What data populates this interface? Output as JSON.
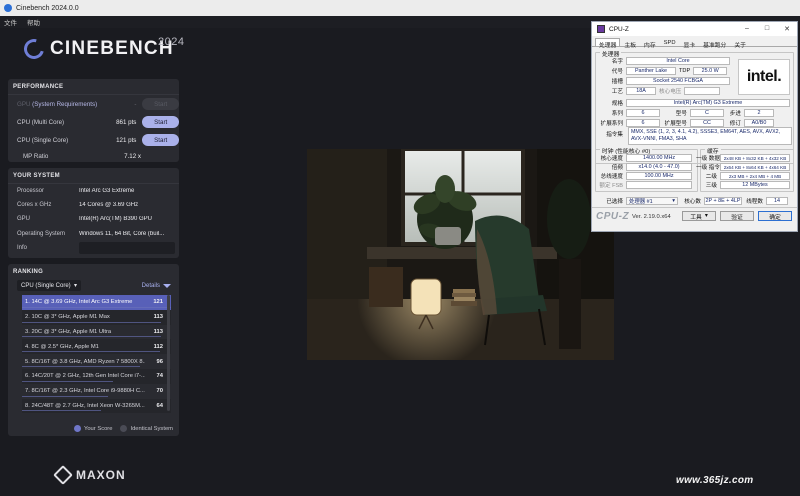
{
  "window": {
    "title": "Cinebench 2024.0.0"
  },
  "menu": {
    "file": "文件",
    "help": "帮助"
  },
  "brand": {
    "name": "CINEBENCH",
    "year": "2024",
    "footer": "MAXON"
  },
  "performance": {
    "heading": "PERFORMANCE",
    "gpu": {
      "label_main": "GPU",
      "label_extra": "(System Requirements)",
      "value": "-",
      "button": "Start"
    },
    "multi": {
      "label": "CPU (Multi Core)",
      "value": "861 pts",
      "button": "Start"
    },
    "single": {
      "label": "CPU (Single Core)",
      "value": "121 pts",
      "button": "Start"
    },
    "ratio": {
      "label": "MP Ratio",
      "value": "7.12 x"
    }
  },
  "system": {
    "heading": "YOUR SYSTEM",
    "rows": [
      {
        "key": "Processor",
        "value": "Intel Arc G3 Extreme"
      },
      {
        "key": "Cores x GHz",
        "value": "14 Cores @ 3.69 GHz"
      },
      {
        "key": "GPU",
        "value": "Intel(R) Arc(TM) B390 GPU"
      },
      {
        "key": "Operating System",
        "value": "Windows 11, 64 Bit, Core (buil..."
      },
      {
        "key": "Info",
        "value": ""
      }
    ]
  },
  "ranking": {
    "heading": "RANKING",
    "mode": "CPU (Single Core)",
    "details": "Details",
    "items": [
      {
        "text": "1. 14C @ 3.69 GHz, Intel Arc G3 Extreme",
        "score": "121"
      },
      {
        "text": "2. 10C @ 3* GHz, Apple M1 Max",
        "score": "113"
      },
      {
        "text": "3. 20C @ 3* GHz, Apple M1 Ultra",
        "score": "113"
      },
      {
        "text": "4. 8C @ 2.5* GHz, Apple M1",
        "score": "112"
      },
      {
        "text": "5. 8C/16T @ 3.8 GHz, AMD Ryzen 7 5800X 8...",
        "score": "96"
      },
      {
        "text": "6. 14C/20T @ 2 GHz, 12th Gen Intel Core i7-...",
        "score": "74"
      },
      {
        "text": "7. 8C/16T @ 2.3 GHz, Intel Core i9-9880H C...",
        "score": "70"
      },
      {
        "text": "8. 24C/48T @ 2.7 GHz, Intel Xeon W-3265M...",
        "score": "64"
      }
    ],
    "legend": {
      "yours": "Your Score",
      "identical": "Identical System"
    }
  },
  "cpuz": {
    "title": "CPU-Z",
    "tabs": [
      "处理器",
      "主板",
      "内存",
      "SPD",
      "显卡",
      "基准跑分",
      "关于"
    ],
    "processor_group": "处理器",
    "name_label": "名字",
    "name": "Intel Core",
    "codename_label": "代号",
    "codename": "Panther Lake",
    "tdp_label": "TDP",
    "tdp": "25.0 W",
    "package_label": "插槽",
    "package": "Socket 2540 FCBGA",
    "tech_label": "工艺",
    "tech": "18A",
    "voltage_label": "核心电压",
    "spec_label": "规格",
    "spec": "Intel(R) Arc(TM) G3 Extreme",
    "family_label": "系列",
    "family": "6",
    "model_label": "型号",
    "model": "C",
    "stepping_label": "步进",
    "stepping": "2",
    "extfamily_label": "扩展系列",
    "extfamily": "6",
    "extmodel_label": "扩展型号",
    "extmodel": "CC",
    "revision_label": "修订",
    "revision": "A0/B0",
    "instr_label": "指令集",
    "instr": "MMX, SSE (1, 2, 3, 4.1, 4.2), SSSE3, EM64T, AES, AVX, AVX2, AVX-VNNI, FMA3, SHA",
    "clocks_group": "时钟 (性能核心 #0)",
    "core_speed_label": "核心速度",
    "core_speed": "1400.00 MHz",
    "multiplier_label": "倍频",
    "multiplier": "x14.0 (4.0 - 47.0)",
    "bus_label": "总线速度",
    "bus": "100.00 MHz",
    "fsb_label": "额定 FSB",
    "cache_group": "缓存",
    "l1d_label": "一级 数据",
    "l1d": "2x48 KB + 8x32 KB + 4x32 KB",
    "l1i_label": "一级 指令",
    "l1i": "2x64 KB + 8x64 KB + 4x64 KB",
    "l2_label": "二级",
    "l2": "2x3 MB + 2x4 MB + 4 MB",
    "l3_label": "三级",
    "l3": "12 MBytes",
    "selection_label": "已选择",
    "selection": "处理器 #1",
    "cores_label": "核心数",
    "cores": "2P + 8E + 4LP",
    "threads_label": "线程数",
    "threads": "14",
    "brand": "CPU-Z",
    "version": "Ver. 2.19.0.x64",
    "tools": "工具",
    "validate": "验证",
    "ok": "确定"
  },
  "watermark": "www.365jz.com",
  "colors": {
    "accent": "#aab1ea",
    "selected_row": "#5860b8",
    "your_score": "#6f76c8",
    "identical": "#4a4b55"
  }
}
